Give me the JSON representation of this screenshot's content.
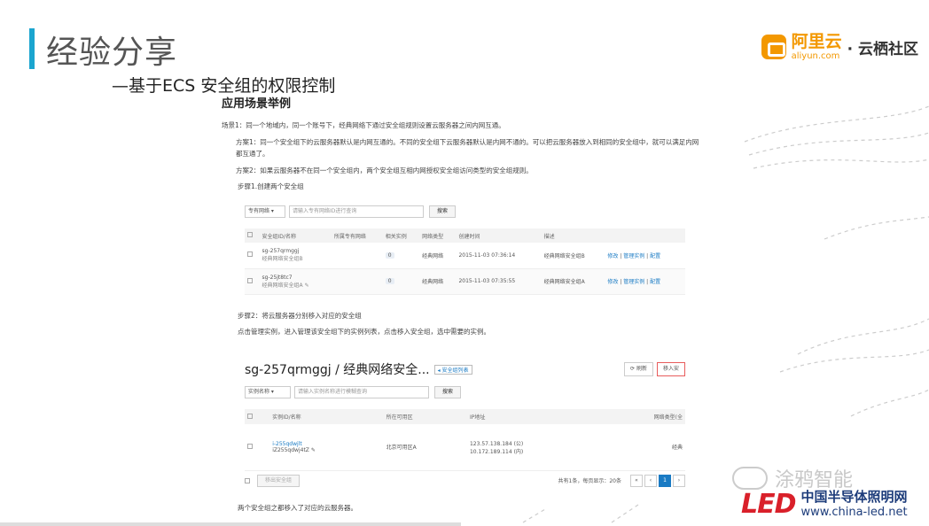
{
  "slide": {
    "title": "经验分享",
    "subtitle": "—基于ECS 安全组的权限控制",
    "logo_cn": "阿里云",
    "logo_en": "aliyun.com",
    "logo_sub": "· 云栖社区",
    "brand_cn": "中国半导体照明网",
    "brand_url": "www.china-led.net",
    "brand_mark": "LED",
    "watermark": "涂鸦智能",
    "accent": "#1ba5cf",
    "logo_color": "#f39800"
  },
  "content": {
    "section_title": "应用场景举例",
    "scene": "场景1：同一个地域内，同一个账号下，经典网络下通过安全组规则设置云服务器之间内网互通。",
    "plan1": "方案1：同一个安全组下的云服务器默认是内网互通的。不同的安全组下云服务器默认是内网不通的。可以把云服务器放入到相同的安全组中，就可以满足内网都互通了。",
    "plan2": "方案2：如果云服务器不在同一个安全组内，两个安全组互相内网授权安全组访问类型的安全组规则。",
    "step1": "步骤1.创建两个安全组",
    "step2": "步骤2：将云服务器分别移入对应的安全组",
    "step2_desc": "点击管理实例，进入管理该安全组下的实例列表，点击移入安全组，选中需要的实例。",
    "footer_cut": "两个安全组之都移入了对应的云服务器。"
  },
  "panel1": {
    "select": "专有网络 ▾",
    "search_placeholder": "请输入专有网络ID进行查询",
    "search_btn": "搜索",
    "headers": [
      "安全组ID/名称",
      "所属专有网络",
      "相关实例",
      "网络类型",
      "创建时间",
      "描述"
    ],
    "rows": [
      {
        "id": "sg-257qrmggj",
        "name": "经典网络安全组B",
        "count": "0",
        "type": "经典网络",
        "time": "2015-11-03 07:36:14",
        "desc": "经典网络安全组B",
        "a1": "修改",
        "a2": "管理实例",
        "a3": "配置"
      },
      {
        "id": "sg-25jt8tc7",
        "name": "经典网络安全组A",
        "count": "0",
        "type": "经典网络",
        "time": "2015-11-03 07:35:55",
        "desc": "经典网络安全组A",
        "a1": "修改",
        "a2": "管理实例",
        "a3": "配置"
      }
    ]
  },
  "panel2": {
    "title": "sg-257qrmggj / 经典网络安全...",
    "tag": "◂ 安全组列表",
    "refresh": "⟳ 刷新",
    "move_in": "移入安",
    "select": "实例名称 ▾",
    "search_placeholder": "请输入实例名称进行模糊查询",
    "search_btn": "搜索",
    "headers": [
      "实例ID/名称",
      "所在可用区",
      "IP地址",
      "网络类型(全"
    ],
    "row": {
      "id": "i-255qdwjlt",
      "name": "iZ255qdwj4tZ",
      "zone": "北京可用区A",
      "ip1": "123.57.138.184 (公)",
      "ip2": "10.172.189.114 (内)",
      "type": "经典"
    },
    "remove_btn": "移出安全组",
    "pagination_info": "共有1条，每页显示：20条",
    "pages": [
      "«",
      "‹",
      "1",
      "›"
    ]
  }
}
